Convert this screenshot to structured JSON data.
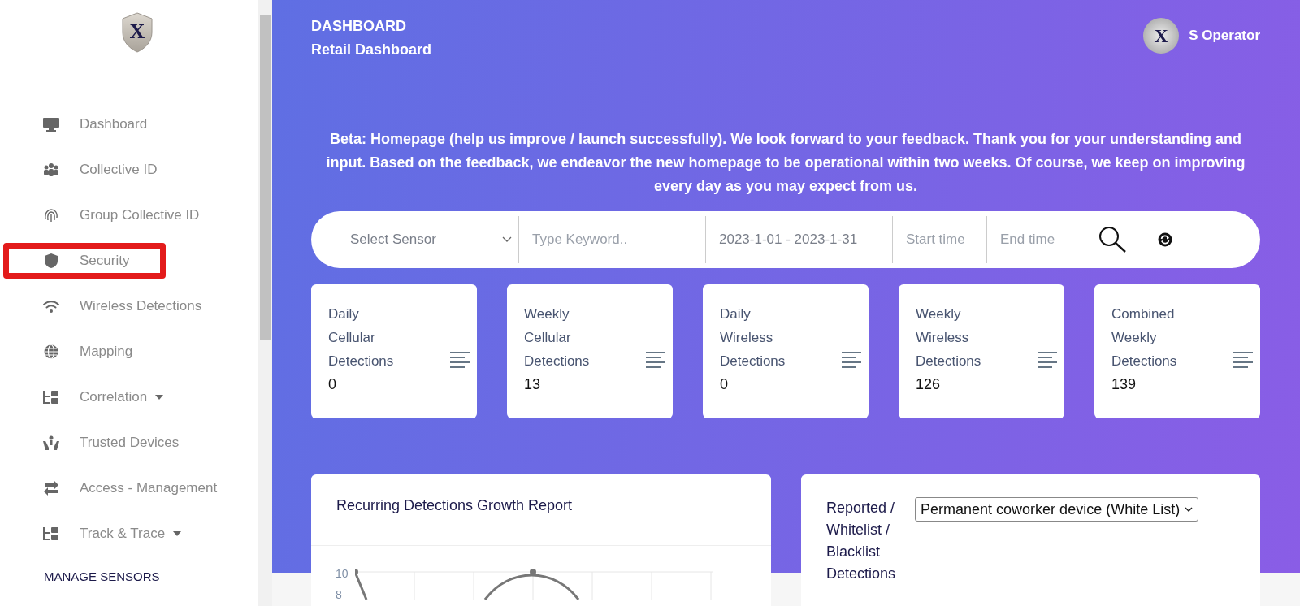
{
  "sidebar": {
    "items": [
      {
        "label": "Dashboard",
        "kind": "monitor",
        "has_caret": false,
        "highlighted": false
      },
      {
        "label": "Collective ID",
        "kind": "people",
        "has_caret": false,
        "highlighted": false
      },
      {
        "label": "Group Collective ID",
        "kind": "fingerprint",
        "has_caret": false,
        "highlighted": false
      },
      {
        "label": "Security",
        "kind": "shield",
        "has_caret": false,
        "highlighted": true
      },
      {
        "label": "Wireless Detections",
        "kind": "wifi",
        "has_caret": false,
        "highlighted": false
      },
      {
        "label": "Mapping",
        "kind": "globe",
        "has_caret": false,
        "highlighted": false
      },
      {
        "label": "Correlation",
        "kind": "tree",
        "has_caret": true,
        "highlighted": false
      },
      {
        "label": "Trusted Devices",
        "kind": "hands",
        "has_caret": false,
        "highlighted": false
      },
      {
        "label": "Access - Management",
        "kind": "swap",
        "has_caret": false,
        "highlighted": false
      },
      {
        "label": "Track & Trace",
        "kind": "tree",
        "has_caret": true,
        "highlighted": false
      }
    ],
    "section_heading": "MANAGE SENSORS"
  },
  "logo_letter": "X",
  "header": {
    "title": "DASHBOARD",
    "subtitle": "Retail Dashboard",
    "user": {
      "avatar_letter": "X",
      "name": "S Operator"
    }
  },
  "notice": "Beta: Homepage (help us improve / launch successfully). We look forward to your feedback. Thank you for your understanding and input. Based on the feedback, we endeavor the new homepage to be operational within two weeks. Of course, we keep on improving every day as you may expect from us.",
  "filters": {
    "sensor_placeholder": "Select Sensor",
    "keyword_placeholder": "Type Keyword..",
    "date_range": "2023-1-01 - 2023-1-31",
    "start_placeholder": "Start time",
    "end_placeholder": "End time"
  },
  "stat_cards": [
    {
      "label_lines": [
        "Daily",
        "Cellular",
        "Detections"
      ],
      "value": "0"
    },
    {
      "label_lines": [
        "Weekly",
        "Cellular",
        "Detections"
      ],
      "value": "13"
    },
    {
      "label_lines": [
        "Daily",
        "Wireless",
        "Detections"
      ],
      "value": "0"
    },
    {
      "label_lines": [
        "Weekly",
        "Wireless",
        "Detections"
      ],
      "value": "126"
    },
    {
      "label_lines": [
        "Combined",
        "Weekly",
        "Detections"
      ],
      "value": "139"
    }
  ],
  "growth_panel": {
    "title": "Recurring Detections Growth Report",
    "axis_labels": [
      "10",
      "8"
    ]
  },
  "list_panel": {
    "title_lines": [
      "Reported /",
      "Whitelist /",
      "Blacklist",
      "Detections"
    ],
    "selected_option": "Permanent coworker device (White List)"
  }
}
